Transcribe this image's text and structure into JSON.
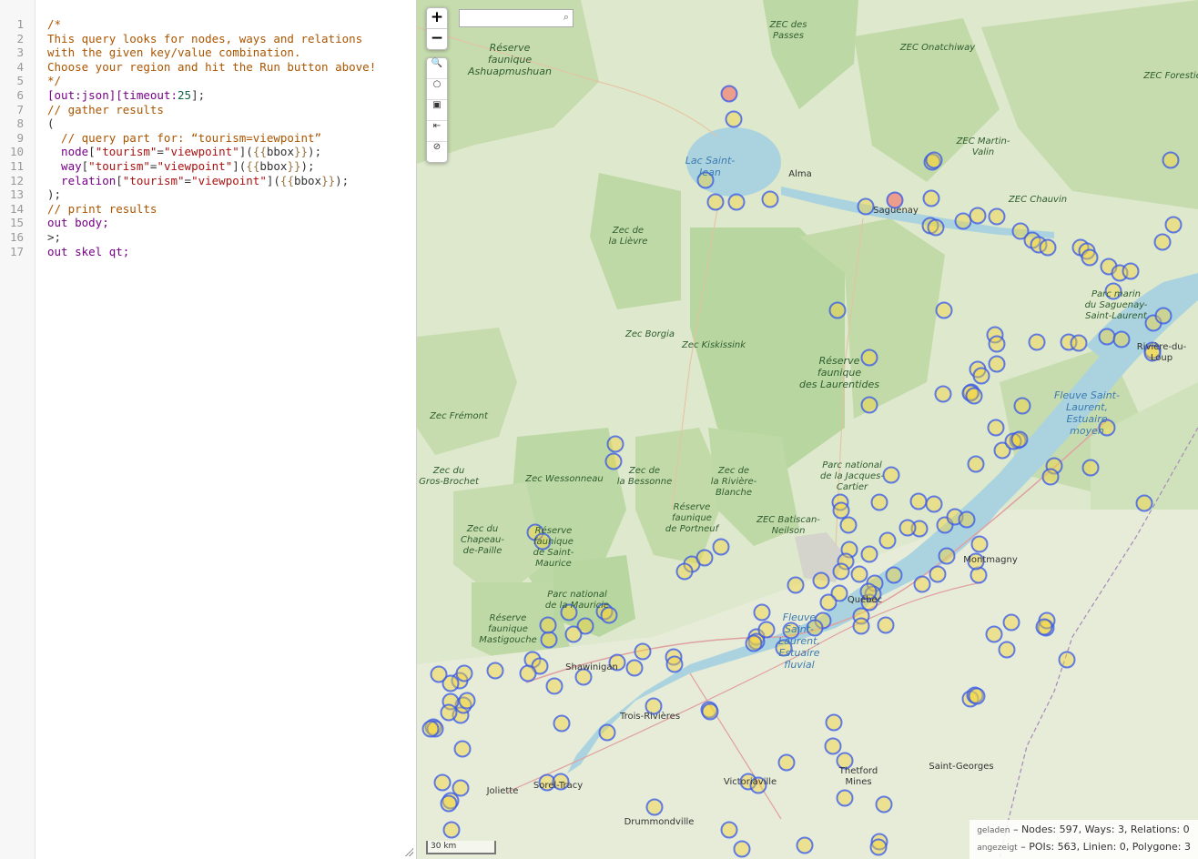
{
  "editor": {
    "line_numbers": [
      "1",
      "2",
      "3",
      "4",
      "5",
      "6",
      "7",
      "8",
      "9",
      "10",
      "11",
      "12",
      "13",
      "14",
      "15",
      "16",
      "17"
    ],
    "lines": [
      [
        {
          "t": "/*",
          "c": "comment"
        }
      ],
      [
        {
          "t": "This query looks for nodes, ways and relations",
          "c": "comment"
        }
      ],
      [
        {
          "t": "with the given key/value combination.",
          "c": "comment"
        }
      ],
      [
        {
          "t": "Choose your region and hit the Run button above!",
          "c": "comment"
        }
      ],
      [
        {
          "t": "*/",
          "c": "comment"
        }
      ],
      [
        {
          "t": "[out:json][timeout:",
          "c": "kw"
        },
        {
          "t": "25",
          "c": "num"
        },
        {
          "t": "];",
          "c": ""
        }
      ],
      [
        {
          "t": "// gather results",
          "c": "comment"
        }
      ],
      [
        {
          "t": "(",
          "c": ""
        }
      ],
      [
        {
          "t": "  // query part for: “tourism=viewpoint”",
          "c": "comment"
        }
      ],
      [
        {
          "t": "  node",
          "c": "kw"
        },
        {
          "t": "[",
          "c": ""
        },
        {
          "t": "\"tourism\"",
          "c": "str"
        },
        {
          "t": "=",
          "c": ""
        },
        {
          "t": "\"viewpoint\"",
          "c": "str"
        },
        {
          "t": "](",
          "c": ""
        },
        {
          "t": "{{",
          "c": "br"
        },
        {
          "t": "bbox",
          "c": ""
        },
        {
          "t": "}}",
          "c": "br"
        },
        {
          "t": ");",
          "c": ""
        }
      ],
      [
        {
          "t": "  way",
          "c": "kw"
        },
        {
          "t": "[",
          "c": ""
        },
        {
          "t": "\"tourism\"",
          "c": "str"
        },
        {
          "t": "=",
          "c": ""
        },
        {
          "t": "\"viewpoint\"",
          "c": "str"
        },
        {
          "t": "](",
          "c": ""
        },
        {
          "t": "{{",
          "c": "br"
        },
        {
          "t": "bbox",
          "c": ""
        },
        {
          "t": "}}",
          "c": "br"
        },
        {
          "t": ");",
          "c": ""
        }
      ],
      [
        {
          "t": "  relation",
          "c": "kw"
        },
        {
          "t": "[",
          "c": ""
        },
        {
          "t": "\"tourism\"",
          "c": "str"
        },
        {
          "t": "=",
          "c": ""
        },
        {
          "t": "\"viewpoint\"",
          "c": "str"
        },
        {
          "t": "](",
          "c": ""
        },
        {
          "t": "{{",
          "c": "br"
        },
        {
          "t": "bbox",
          "c": ""
        },
        {
          "t": "}}",
          "c": "br"
        },
        {
          "t": ");",
          "c": ""
        }
      ],
      [
        {
          "t": ");",
          "c": ""
        }
      ],
      [
        {
          "t": "// print results",
          "c": "comment"
        }
      ],
      [
        {
          "t": "out body;",
          "c": "kw"
        }
      ],
      [
        {
          "t": ">;",
          "c": ""
        }
      ],
      [
        {
          "t": "out skel qt;",
          "c": "kw"
        }
      ]
    ]
  },
  "map": {
    "zoom_in": "+",
    "zoom_out": "−",
    "search_placeholder": "",
    "search_icon": "magnifier-icon",
    "tools": [
      "zoom-to-data-icon",
      "locate-icon",
      "export-image-icon",
      "fullscreen-icon",
      "clear-icon"
    ],
    "scale": "30 km",
    "stats": {
      "loaded_label": "geladen",
      "loaded_value": "– Nodes: 597, Ways: 3, Relations: 0",
      "shown_label": "angezeigt",
      "shown_value": "– POIs: 563, Linien: 0, Polygone: 3"
    },
    "labels": [
      {
        "text": "Réserve\nfaunique\nAshuapmushuan",
        "cls": "park"
      },
      {
        "text": "ZEC des\nPasses",
        "cls": ""
      },
      {
        "text": "ZEC Onatchiway",
        "cls": ""
      },
      {
        "text": "ZEC Forestie",
        "cls": ""
      },
      {
        "text": "Lac Saint-\nJean",
        "cls": "water"
      },
      {
        "text": "Alma",
        "cls": "city"
      },
      {
        "text": "Saguenay",
        "cls": "city"
      },
      {
        "text": "ZEC Martin-\nValin",
        "cls": ""
      },
      {
        "text": "ZEC Chauvin",
        "cls": ""
      },
      {
        "text": "Zec de\nla Lièvre",
        "cls": ""
      },
      {
        "text": "Parc marin\ndu Saguenay-\nSaint-Laurent",
        "cls": ""
      },
      {
        "text": "Zec Borgia",
        "cls": ""
      },
      {
        "text": "Zec Kiskissink",
        "cls": ""
      },
      {
        "text": "Réserve\nfaunique\ndes Laurentides",
        "cls": "park"
      },
      {
        "text": "Rivière-du-\nLoup",
        "cls": "city"
      },
      {
        "text": "Fleuve Saint-\nLaurent,\nEstuaire\nmoyen",
        "cls": "water"
      },
      {
        "text": "Zec Frémont",
        "cls": ""
      },
      {
        "text": "Zec du\nGros-Brochet",
        "cls": ""
      },
      {
        "text": "Zec Wessonneau",
        "cls": ""
      },
      {
        "text": "Zec de\nla Bessonne",
        "cls": ""
      },
      {
        "text": "Zec de\nla Rivière-\nBlanche",
        "cls": ""
      },
      {
        "text": "Parc national\nde la Jacques-\nCartier",
        "cls": ""
      },
      {
        "text": "Zec du\nChapeau-\nde-Paille",
        "cls": ""
      },
      {
        "text": "Réserve\nfaunique\nde Saint-\nMaurice",
        "cls": ""
      },
      {
        "text": "Réserve\nfaunique\nde Portneuf",
        "cls": ""
      },
      {
        "text": "ZEC Batiscan-\nNeilson",
        "cls": ""
      },
      {
        "text": "Montmagny",
        "cls": "city"
      },
      {
        "text": "Parc national\nde la Mauricie",
        "cls": ""
      },
      {
        "text": "Québec",
        "cls": "city"
      },
      {
        "text": "Réserve\nfaunique\nMastigouche",
        "cls": ""
      },
      {
        "text": "Fleuve\nSaint-\nLaurent,\nEstuaire\nfluvial",
        "cls": "water"
      },
      {
        "text": "Shawinigan",
        "cls": "city"
      },
      {
        "text": "Trois-Rivières",
        "cls": "city"
      },
      {
        "text": "Joliette",
        "cls": "city"
      },
      {
        "text": "Sorel-Tracy",
        "cls": "city"
      },
      {
        "text": "Victoriaville",
        "cls": "city"
      },
      {
        "text": "Thetford\nMines",
        "cls": "city"
      },
      {
        "text": "Saint-Georges",
        "cls": "city"
      },
      {
        "text": "Drummondville",
        "cls": "city"
      }
    ],
    "colors": {
      "land": "#dde8cc",
      "forest": "#b8d6a0",
      "water": "#aad3df",
      "marker_fill": "#f5d43c",
      "marker_stroke": "#3355ee",
      "marker_red": "#f08a7a"
    }
  }
}
